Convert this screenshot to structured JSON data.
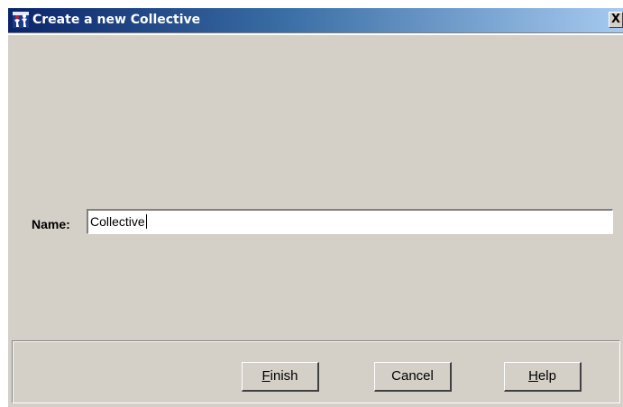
{
  "window": {
    "title": "Create a new Collective",
    "close_glyph": "X",
    "title_icon": "people-figure-icon",
    "accent_color": "#0a246a"
  },
  "form": {
    "name_label": "Name:",
    "name_value": "Collective"
  },
  "buttons": {
    "finish": {
      "mnemonic": "F",
      "rest": "inish"
    },
    "cancel": {
      "label": "Cancel"
    },
    "help": {
      "mnemonic": "H",
      "rest": "elp"
    }
  }
}
